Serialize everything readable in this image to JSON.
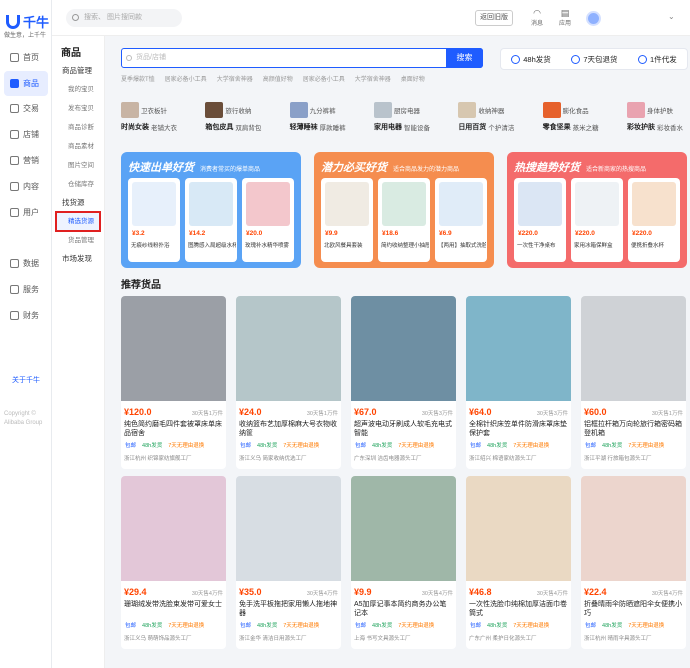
{
  "app": {
    "logo_text": "千牛",
    "slogan": "做生意，上千牛",
    "about": "关于千牛",
    "copyright": "Copyright © Alibaba Group"
  },
  "nav": [
    {
      "label": "首页",
      "icon": "home-icon"
    },
    {
      "label": "商品",
      "icon": "goods-icon"
    },
    {
      "label": "交易",
      "icon": "trade-icon"
    },
    {
      "label": "店铺",
      "icon": "shop-icon"
    },
    {
      "label": "营销",
      "icon": "marketing-icon"
    },
    {
      "label": "内容",
      "icon": "content-icon"
    },
    {
      "label": "用户",
      "icon": "user-icon"
    },
    {
      "label": "数据",
      "icon": "data-icon"
    },
    {
      "label": "服务",
      "icon": "service-icon"
    },
    {
      "label": "财务",
      "icon": "finance-icon"
    }
  ],
  "topbar": {
    "search_placeholder": "搜索、 图片搜同款",
    "old_version": "返回旧版",
    "msg": "消息",
    "msg_icon": "chat-icon",
    "app_icon": "app-icon",
    "app": "应用"
  },
  "sub": {
    "title": "商品",
    "group1": "商品管理",
    "items1": [
      "我的宝贝",
      "发布宝贝",
      "商品诊断",
      "商品素材",
      "图片空间",
      "仓储库存"
    ],
    "group2": "找货源",
    "items2": [
      "精选货源",
      "货品管理"
    ],
    "group3": "市场发现"
  },
  "search": {
    "placeholder": "货品/店铺",
    "button": "搜索"
  },
  "services": [
    {
      "label": "48h发货",
      "icon": "truck-icon"
    },
    {
      "label": "7天包退货",
      "icon": "refund-icon"
    },
    {
      "label": "1件代发",
      "icon": "box-icon"
    }
  ],
  "hot": [
    "夏季爆款T恤",
    "居家必备小工具",
    "大学宿舍神器",
    "高颜值好物",
    "居家必备小工具",
    "大学宿舍神器",
    "桌面好物"
  ],
  "categories": [
    {
      "main": "时尚女装",
      "a": "卫衣板针",
      "b": "老铺大衣",
      "color": "#c8b4a4"
    },
    {
      "main": "箱包皮具",
      "a": "旅行收纳",
      "b": "双肩背包",
      "color": "#6b4e3a"
    },
    {
      "main": "轻薄睡袜",
      "a": "九分裤裤",
      "b": "厚款睡裤",
      "color": "#8aa0c8"
    },
    {
      "main": "家用电器",
      "a": "厨房电器",
      "b": "智能设备",
      "color": "#b9c3cc"
    },
    {
      "main": "日用百货",
      "a": "收纳神器",
      "b": "个护清洁",
      "color": "#d7c7b0"
    },
    {
      "main": "零食坚果",
      "a": "膨化食品",
      "b": "蒸米之糖",
      "color": "#e6612c"
    },
    {
      "main": "彩妆护肤",
      "a": "身体护肤",
      "b": "彩妆香水",
      "color": "#e9a3b0"
    }
  ],
  "promos": [
    {
      "title": "快速出单好货",
      "sub": "消费者常买的爆单商品",
      "color": "#5aa3f5",
      "items": [
        {
          "price": "¥3.2",
          "name": "无痕纱线粉扑浴",
          "color": "#e7f0fb"
        },
        {
          "price": "¥14.2",
          "name": "图腾感入局超级水杯",
          "color": "#d8e9f6"
        },
        {
          "price": "¥20.0",
          "name": "玫瑰补水精华喷雾",
          "color": "#f3c7cc"
        }
      ]
    },
    {
      "title": "潜力必买好货",
      "sub": "适合商品发力的潜力商品",
      "color": "#f58d4f",
      "items": [
        {
          "price": "¥9.9",
          "name": "北欧风餐具套装",
          "color": "#f0ebe3"
        },
        {
          "price": "¥18.6",
          "name": "简约收纳整理小抽屉",
          "color": "#d9ebe2"
        },
        {
          "price": "¥6.9",
          "name": "【两用】抽取式洗脸巾",
          "color": "#e0ecf8"
        }
      ]
    },
    {
      "title": "热搜趋势好货",
      "sub": "适合新商家的热搜商品",
      "color": "#f46b6b",
      "items": [
        {
          "price": "¥220.0",
          "name": "一次性干净桌布",
          "color": "#dbe6f4"
        },
        {
          "price": "¥220.0",
          "name": "家用冰箱保鲜盒",
          "color": "#eef2f5"
        },
        {
          "price": "¥220.0",
          "name": "便携折叠水杯",
          "color": "#f7e1cd"
        }
      ]
    }
  ],
  "rec_title": "推荐货品",
  "products": [
    {
      "price": "¥120.0",
      "sold": "30天售1万件",
      "name": "纯色简约磨毛四件套被罩床单床品宿舍",
      "tags": [
        "包邮",
        "48h发货",
        "7天无理由退换"
      ],
      "shop": "浙江杭州   织锦家纺旗舰工厂",
      "color": "#9b9fa6"
    },
    {
      "price": "¥24.0",
      "sold": "30天售1万件",
      "name": "收纳篮布艺加厚棉麻大号衣物收纳筐",
      "tags": [
        "包邮",
        "48h发货",
        "7天无理由退换"
      ],
      "shop": "浙江义乌   简家收纳优选工厂",
      "color": "#b5c6c9"
    },
    {
      "price": "¥67.0",
      "sold": "30天售3万件",
      "name": "超声波电动牙刷成人软毛充电式智能",
      "tags": [
        "包邮",
        "48h发货",
        "7天无理由退换"
      ],
      "shop": "广东深圳   洁齿电器源头工厂",
      "color": "#6e8fa3"
    },
    {
      "price": "¥64.0",
      "sold": "30天售3万件",
      "name": "全棉针织床笠单件防滑床罩床垫保护套",
      "tags": [
        "包邮",
        "48h发货",
        "7天无理由退换"
      ],
      "shop": "浙江绍兴   棉语家纺源头工厂",
      "color": "#7fb5c9"
    },
    {
      "price": "¥60.0",
      "sold": "30天售1万件",
      "name": "铝框拉杆箱万向轮旅行箱密码箱登机箱",
      "tags": [
        "包邮",
        "48h发货",
        "7天无理由退换"
      ],
      "shop": "浙江平湖   行旅箱包源头工厂",
      "color": "#cfd2d6"
    },
    {
      "price": "¥29.4",
      "sold": "30天售4万件",
      "name": "珊瑚绒发带洗脸束发带可爱女士",
      "tags": [
        "包邮",
        "48h发货",
        "7天无理由退换"
      ],
      "shop": "浙江义乌   萌萌饰品源头工厂",
      "color": "#e3c7d8"
    },
    {
      "price": "¥35.0",
      "sold": "30天售4万件",
      "name": "免手洗平板拖把家用懒人拖地神器",
      "tags": [
        "包邮",
        "48h发货",
        "7天无理由退换"
      ],
      "shop": "浙江金华   清洁日用源头工厂",
      "color": "#d7dde3"
    },
    {
      "price": "¥9.9",
      "sold": "30天售4万件",
      "name": "A5加厚记事本简约商务办公笔记本",
      "tags": [
        "包邮",
        "48h发货",
        "7天无理由退换"
      ],
      "shop": "上海   书写文具源头工厂",
      "color": "#9fb7a8"
    },
    {
      "price": "¥46.8",
      "sold": "30天售4万件",
      "name": "一次性洗脸巾纯棉加厚洁面巾卷筒式",
      "tags": [
        "包邮",
        "48h发货",
        "7天无理由退换"
      ],
      "shop": "广东广州   柔护日化源头工厂",
      "color": "#ead9c3"
    },
    {
      "price": "¥22.4",
      "sold": "30天售4万件",
      "name": "折叠晴雨伞防晒遮阳伞女便携小巧",
      "tags": [
        "包邮",
        "48h发货",
        "7天无理由退换"
      ],
      "shop": "浙江杭州   晴雨伞具源头工厂",
      "color": "#ecd5cd"
    }
  ]
}
